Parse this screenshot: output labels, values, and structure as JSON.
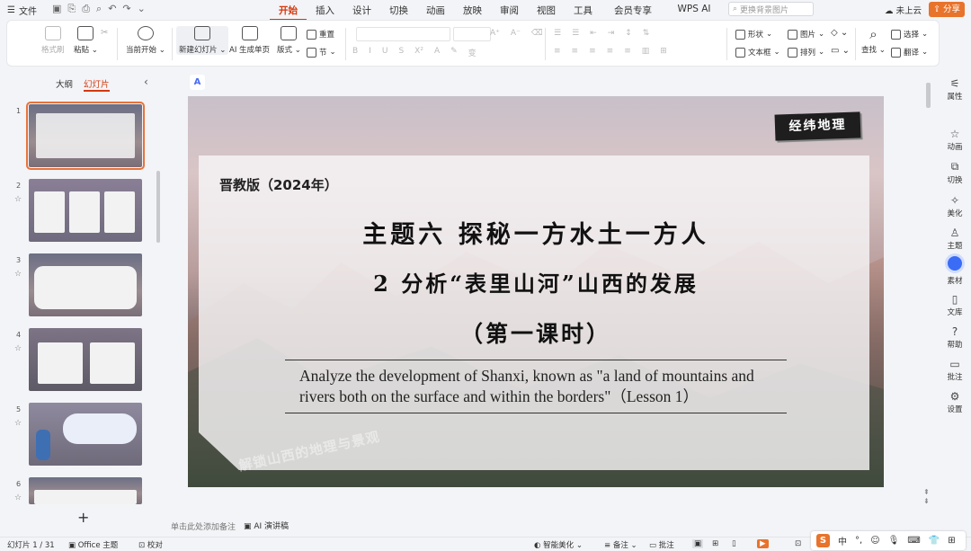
{
  "topbar": {
    "file_label": "文件",
    "tabs": [
      "开始",
      "插入",
      "设计",
      "切换",
      "动画",
      "放映",
      "审阅",
      "视图",
      "工具",
      "会员专享",
      "WPS AI"
    ],
    "active_tab": "开始",
    "search_placeholder": "更换背景图片",
    "cloud_label": "未上云",
    "share_label": "分享"
  },
  "ribbon": {
    "format_painter": "格式刷",
    "paste": "粘贴",
    "from_current": "当前开始",
    "new_slide": "新建幻灯片",
    "ai_single": "AI 生成单页",
    "layout": "版式",
    "reset": "重置",
    "section": "节",
    "shape": "形状",
    "picture": "图片",
    "textbox": "文本框",
    "arrange": "排列",
    "find": "查找",
    "select": "选择",
    "translate": "翻译"
  },
  "left_panel": {
    "tab_outline": "大纲",
    "tab_slides": "幻灯片",
    "slide_numbers": [
      "1",
      "2",
      "3",
      "4",
      "5",
      "6"
    ],
    "add_slide": "+"
  },
  "slide": {
    "stamp": "经纬地理",
    "edition": "晋教版（2024年）",
    "title_line1": "主题六  探秘一方水土一方人",
    "title_line2": "2  分析“表里山河”山西的发展",
    "title_line3": "（第一课时）",
    "english": "Analyze the development of Shanxi, known as \"a land of mountains and rivers both on the surface and within the borders\"（Lesson 1）",
    "watermark": "解锁山西的地理与景观"
  },
  "right_bar": [
    "属性",
    "动画",
    "切换",
    "美化",
    "主题",
    "素材",
    "文库",
    "帮助",
    "批注",
    "设置"
  ],
  "notes": {
    "placeholder": "单击此处添加备注",
    "ai_speech": "AI 演讲稿"
  },
  "status": {
    "slide_count": "幻灯片 1 / 31",
    "theme": "Office 主题",
    "proofread": "校对",
    "smart_beautify": "智能美化",
    "notes": "备注",
    "comments": "批注"
  },
  "ime": {
    "lang": "中"
  },
  "colors": {
    "accent": "#d4380d",
    "share_bg": "#e8732b",
    "ai_blue": "#3b6cf6"
  }
}
